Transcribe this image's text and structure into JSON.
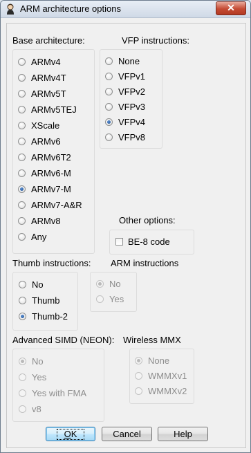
{
  "window": {
    "title": "ARM architecture options",
    "close_glyph": "✕"
  },
  "base_architecture": {
    "label": "Base architecture:",
    "options": [
      "ARMv4",
      "ARMv4T",
      "ARMv5T",
      "ARMv5TEJ",
      "XScale",
      "ARMv6",
      "ARMv6T2",
      "ARMv6-M",
      "ARMv7-M",
      "ARMv7-A&R",
      "ARMv8",
      "Any"
    ],
    "selected": "ARMv7-M"
  },
  "vfp_instructions": {
    "label": "VFP instructions:",
    "options": [
      "None",
      "VFPv1",
      "VFPv2",
      "VFPv3",
      "VFPv4",
      "VFPv8"
    ],
    "selected": "VFPv4"
  },
  "other_options": {
    "label": "Other options:",
    "be8_label": "BE-8 code",
    "be8_checked": false
  },
  "thumb_instructions": {
    "label": "Thumb instructions:",
    "options": [
      "No",
      "Thumb",
      "Thumb-2"
    ],
    "selected": "Thumb-2"
  },
  "arm_instructions": {
    "label": "ARM instructions",
    "options": [
      "No",
      "Yes"
    ],
    "selected": "No",
    "disabled": true
  },
  "advanced_simd": {
    "label": "Advanced SIMD (NEON):",
    "options": [
      "No",
      "Yes",
      "Yes with FMA",
      "v8"
    ],
    "selected": "No",
    "disabled": true
  },
  "wireless_mmx": {
    "label": "Wireless MMX",
    "options": [
      "None",
      "WMMXv1",
      "WMMXv2"
    ],
    "selected": "None",
    "disabled": true
  },
  "buttons": {
    "ok": "OK",
    "ok_prefix": "O",
    "ok_rest": "K",
    "cancel": "Cancel",
    "help": "Help"
  },
  "icons": {
    "app": "app-person-icon",
    "close": "close-icon"
  }
}
